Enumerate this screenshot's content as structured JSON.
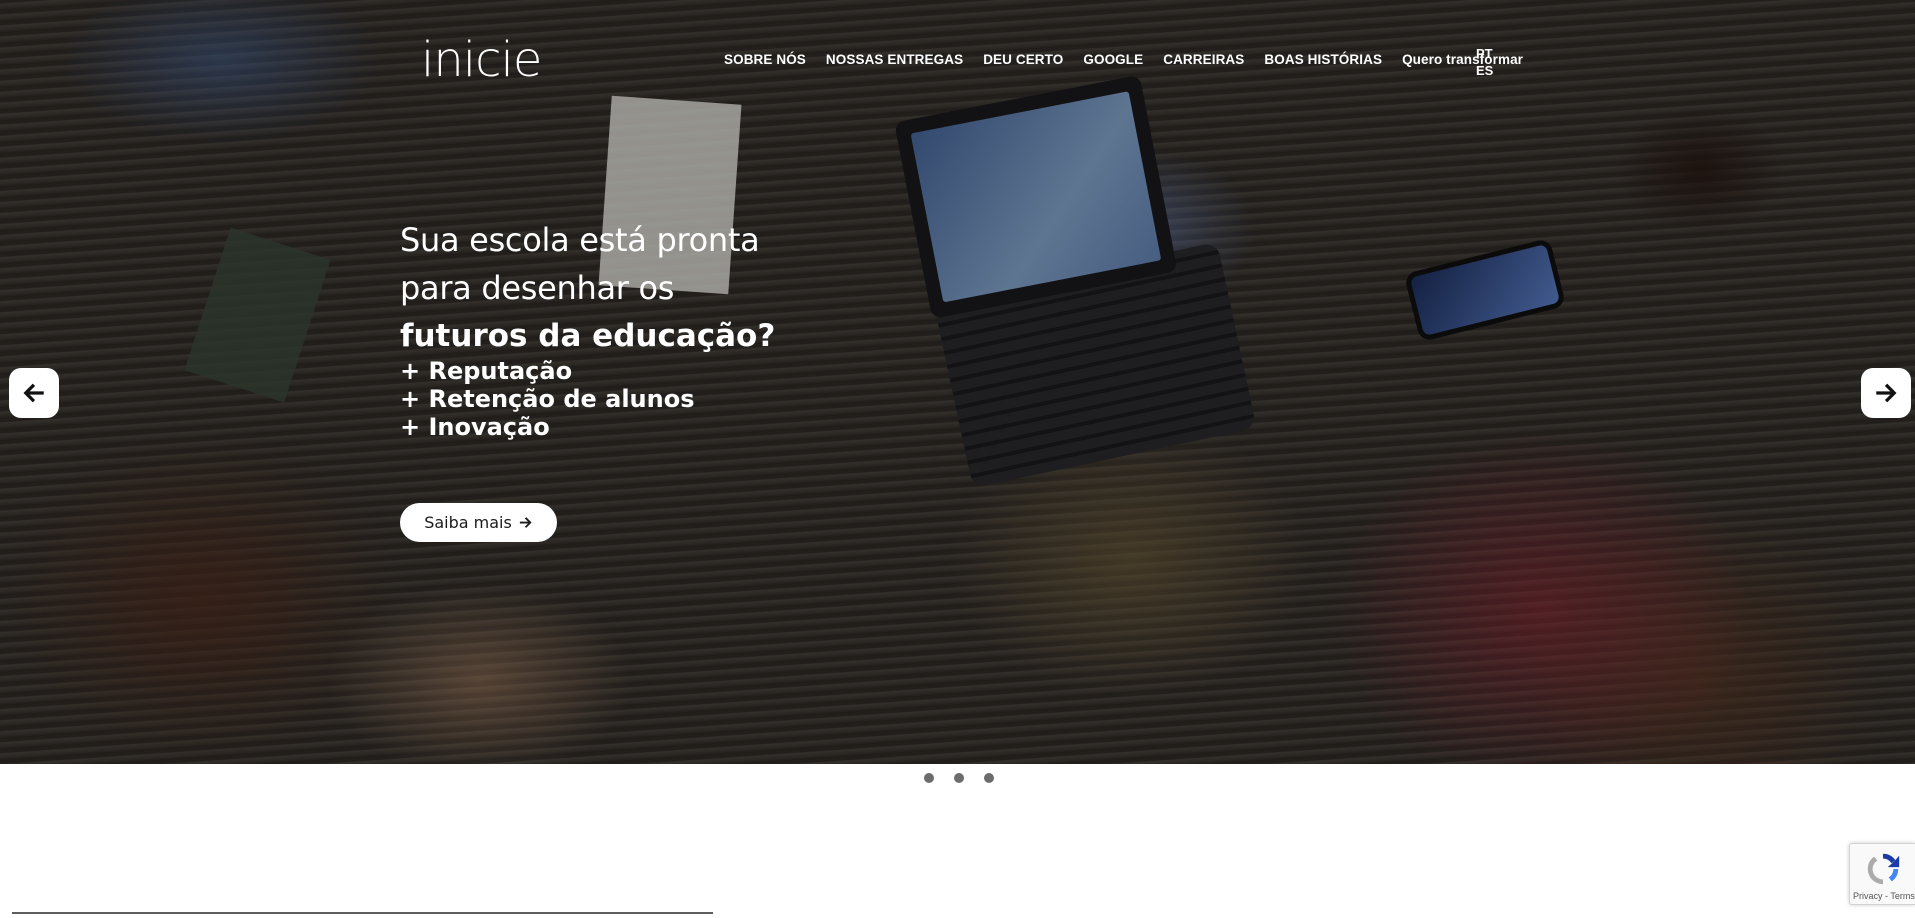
{
  "brand": {
    "logo_text": "inicie"
  },
  "nav": {
    "items": [
      {
        "label": "SOBRE NÓS"
      },
      {
        "label": "NOSSAS ENTREGAS"
      },
      {
        "label": "DEU CERTO"
      },
      {
        "label": "GOOGLE"
      },
      {
        "label": "CARREIRAS"
      },
      {
        "label": "BOAS HISTÓRIAS"
      },
      {
        "label": "Quero transformar"
      }
    ],
    "languages": [
      "PT",
      "ES"
    ]
  },
  "hero": {
    "headline_line1": "Sua escola está pronta",
    "headline_line2": "para desenhar os",
    "headline_bold": "futuros da educação?",
    "bullets": [
      "+ Reputação",
      "+ Retenção de alunos",
      "+ Inovação"
    ],
    "cta_label": "Saiba mais",
    "cta_icon": "arrow-right-icon",
    "prev_icon": "arrow-left-icon",
    "next_icon": "arrow-right-icon"
  },
  "carousel": {
    "slide_count": 3,
    "active_index": 0,
    "dot_color": "#6c6c6c"
  },
  "recaptcha": {
    "links": "Privacy - Terms"
  },
  "colors": {
    "hero_text": "#ffffff",
    "button_bg": "#ffffff",
    "button_text": "#1b1b1b"
  }
}
